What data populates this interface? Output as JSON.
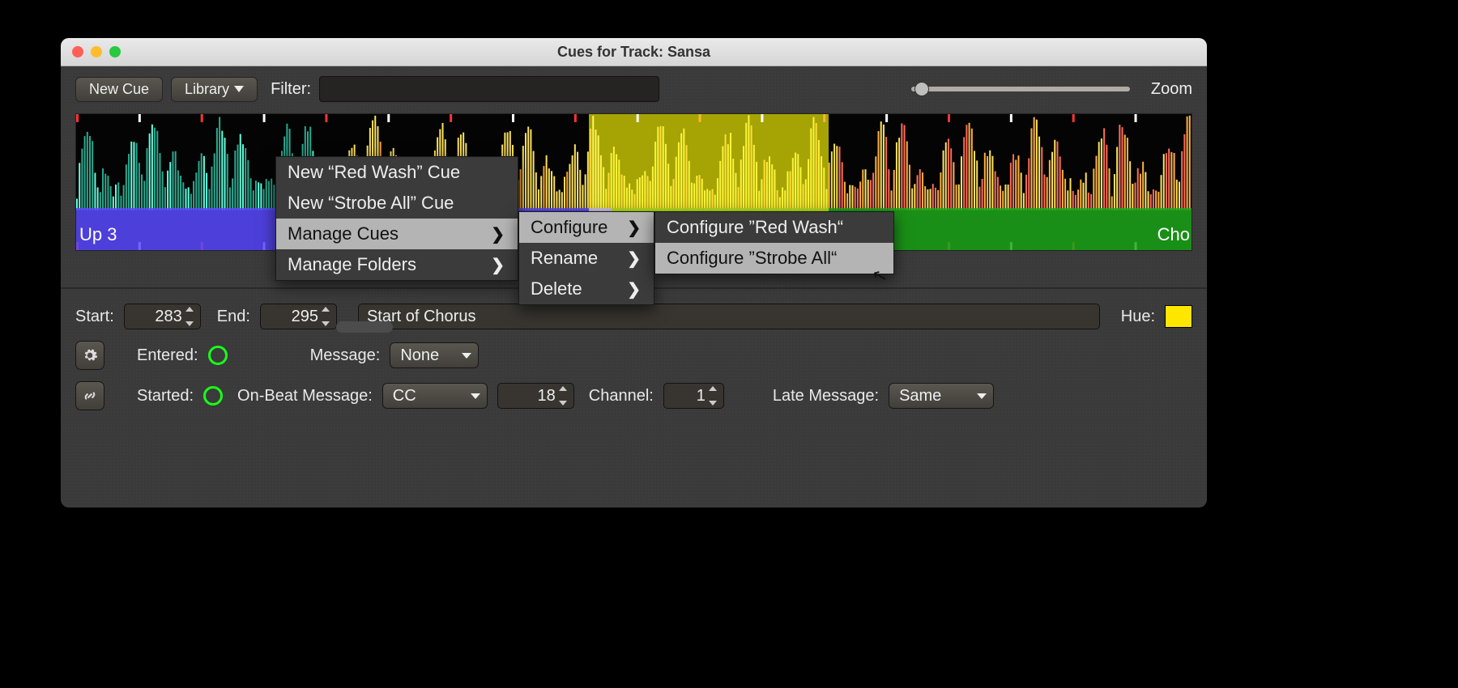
{
  "window": {
    "title": "Cues for Track: Sansa"
  },
  "toolbar": {
    "new_cue": "New Cue",
    "library": "Library",
    "filter_label": "Filter:",
    "zoom_label": "Zoom"
  },
  "library_menu": {
    "items": [
      "New “Red Wash” Cue",
      "New “Strobe All” Cue",
      "Manage Cues",
      "Manage Folders"
    ],
    "highlighted": 2
  },
  "manage_cues_menu": {
    "items": [
      "Configure",
      "Rename",
      "Delete"
    ],
    "highlighted": 0
  },
  "configure_menu": {
    "items": [
      "Configure ”Red Wash“",
      "Configure ”Strobe All“"
    ],
    "highlighted": 1
  },
  "cue_regions": {
    "left_label": "Up 3",
    "right_label": "Cho"
  },
  "inspector": {
    "start_label": "Start:",
    "start_value": "283",
    "end_label": "End:",
    "end_value": "295",
    "comment": "Start of Chorus",
    "hue_label": "Hue:",
    "hue_color": "#ffe600",
    "entered_label": "Entered:",
    "message_label": "Message:",
    "message_value": "None",
    "started_label": "Started:",
    "onbeat_label": "On-Beat Message:",
    "onbeat_value": "CC",
    "onbeat_num": "18",
    "channel_label": "Channel:",
    "channel_value": "1",
    "late_label": "Late Message:",
    "late_value": "Same",
    "gear_icon": "gear",
    "link_icon": "link"
  }
}
